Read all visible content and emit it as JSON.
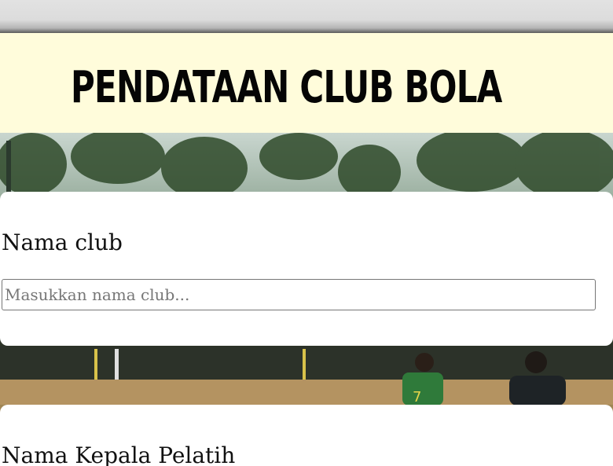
{
  "page": {
    "title": "PENDATAAN CLUB BOLA"
  },
  "form": {
    "club_name": {
      "label": "Nama club",
      "placeholder": "Masukkan nama club...",
      "value": ""
    },
    "head_coach": {
      "label": "Nama Kepala Pelatih"
    }
  },
  "colors": {
    "header_bg": "#fffcdb",
    "card_bg": "#ffffff",
    "title_text": "#050505"
  },
  "background_image": "football-field-photo"
}
